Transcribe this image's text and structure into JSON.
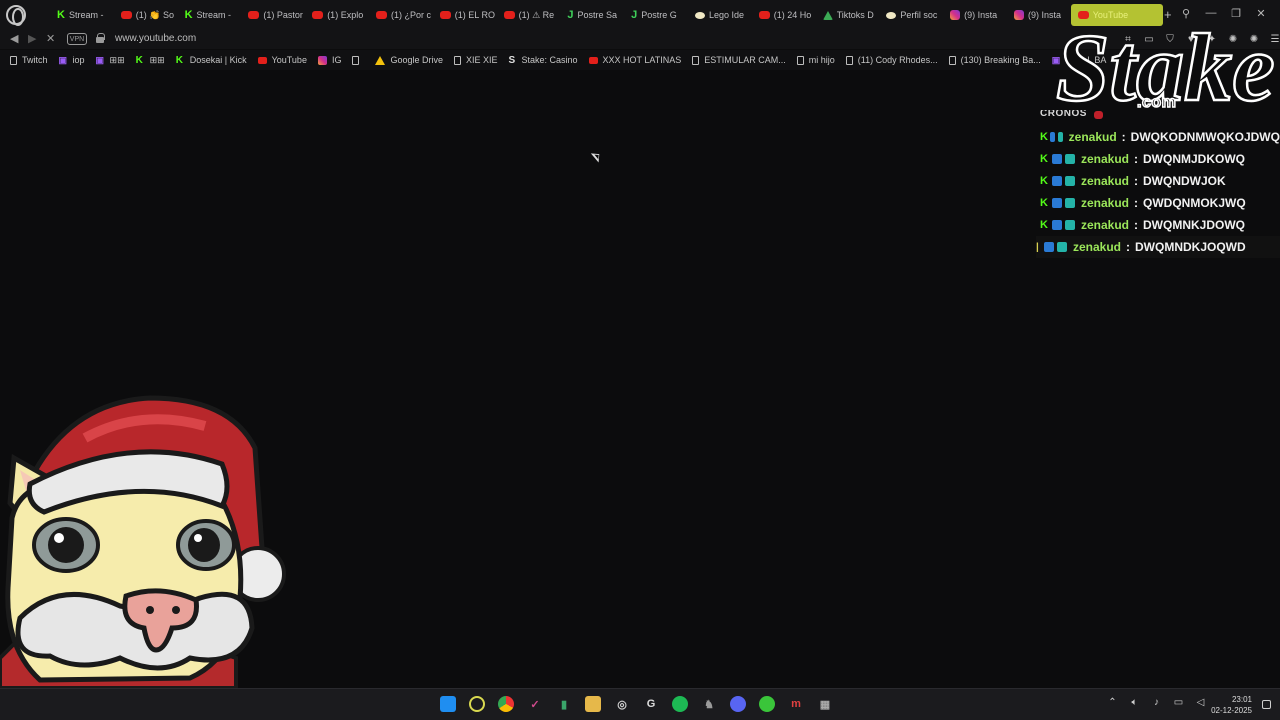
{
  "browser": {
    "tabs": [
      {
        "label": "Stream -",
        "icon": "kick"
      },
      {
        "label": "(1) 👏 So",
        "icon": "yt"
      },
      {
        "label": "Stream -",
        "icon": "kick"
      },
      {
        "label": "(1) Pastor",
        "icon": "yt"
      },
      {
        "label": "(1) Explo",
        "icon": "yt"
      },
      {
        "label": "(1) ¿Por c",
        "icon": "yt"
      },
      {
        "label": "(1) EL RO",
        "icon": "yt"
      },
      {
        "label": "(1) ⚠ Re",
        "icon": "yt"
      },
      {
        "label": "Postre Sa",
        "icon": "jj"
      },
      {
        "label": "Postre G",
        "icon": "jj"
      },
      {
        "label": "Lego Ide",
        "icon": "pf"
      },
      {
        "label": "(1) 24 Ho",
        "icon": "yt"
      },
      {
        "label": "Tiktoks D",
        "icon": "gd"
      },
      {
        "label": "Perfil soc",
        "icon": "pf"
      },
      {
        "label": "(9) Insta",
        "icon": "ig"
      },
      {
        "label": "(9) Insta",
        "icon": "ig"
      },
      {
        "label": "YouTube",
        "icon": "yt",
        "active": true
      }
    ],
    "new_tab": "+",
    "back": "◀",
    "forward": "▶",
    "reload": "✕",
    "vpn_label": "VPN",
    "url": "www.youtube.com",
    "bookmarks": [
      {
        "label": "Twitch",
        "icon": "doc"
      },
      {
        "label": "iop",
        "icon": "twitch"
      },
      {
        "label": "⊞⊞",
        "icon": "twitch"
      },
      {
        "label": "⊞⊞",
        "icon": "kick"
      },
      {
        "label": "Dosekai | Kick",
        "icon": "kick"
      },
      {
        "label": "YouTube",
        "icon": "yt"
      },
      {
        "label": "IG",
        "icon": "ig"
      },
      {
        "label": "",
        "icon": "doc"
      },
      {
        "label": "Google Drive",
        "icon": "gd"
      },
      {
        "label": "XIE XIE",
        "icon": "doc"
      },
      {
        "label": "Stake: Casino",
        "icon": "stake"
      },
      {
        "label": "XXX HOT LATINAS",
        "icon": "yt"
      },
      {
        "label": "ESTIMULAR CAM...",
        "icon": "doc"
      },
      {
        "label": "mi hijo",
        "icon": "doc"
      },
      {
        "label": "(11) Cody Rhodes...",
        "icon": "doc"
      },
      {
        "label": "(130) Breaking Ba...",
        "icon": "doc"
      },
      {
        "label": "Do... L BA",
        "icon": "twitch"
      }
    ],
    "bookmarks_more": "»"
  },
  "overlay": {
    "stake_brand": "Stake",
    "stake_domain": ".com",
    "chat_header": "CRONOS",
    "chat": [
      {
        "user": "zenakud",
        "text": "DWQKODNMWQKOJDWQ"
      },
      {
        "user": "zenakud",
        "text": "DWQNMJDKOWQ"
      },
      {
        "user": "zenakud",
        "text": "DWQNDWJOK"
      },
      {
        "user": "zenakud",
        "text": "QWDQNMOKJWQ"
      },
      {
        "user": "zenakud",
        "text": "DWQMNKJDOWQ"
      },
      {
        "user": "zenakud",
        "text": "DWQMNDKJOQWD"
      }
    ]
  },
  "taskbar": {
    "time": "23:01",
    "date": "02-12-2025"
  },
  "colors": {
    "accent_tab": "#b4c232",
    "kick_green": "#53fc18",
    "chat_user": "#9be65a",
    "background": "#0c0c0d"
  }
}
